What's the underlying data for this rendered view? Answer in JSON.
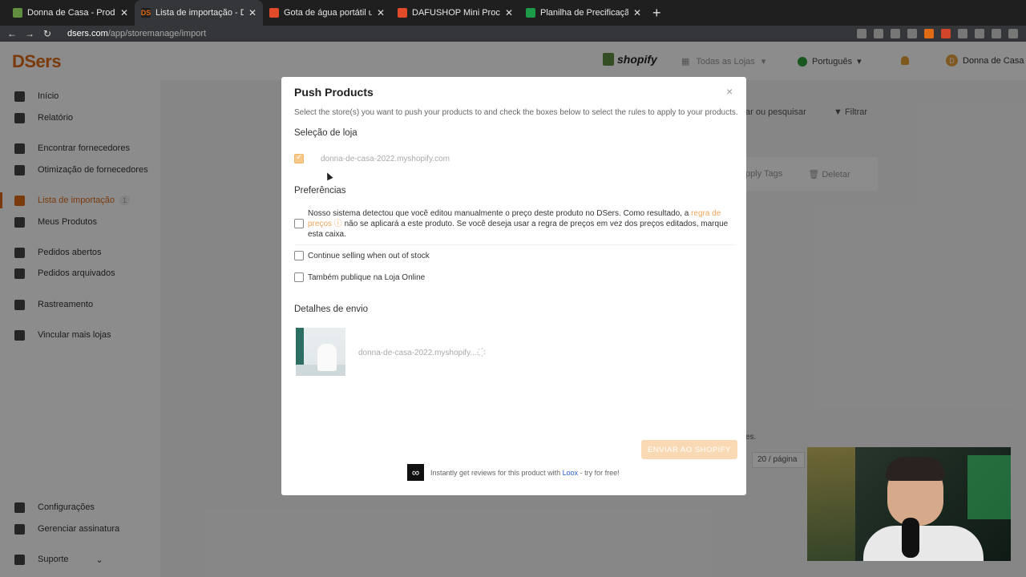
{
  "browser": {
    "tabs": [
      {
        "title": "Donna de Casa - Produtos - Sh",
        "fav_color": "#5e8e3e",
        "fav_icon": "shopify-icon",
        "active": false
      },
      {
        "title": "Lista de importação - DSers - ",
        "fav_color": "#e06b16",
        "fav_icon": "dsers-icon",
        "active": true
      },
      {
        "title": "Gota de água portátil umidifica",
        "fav_color": "#e04b2a",
        "fav_icon": "shop-icon",
        "active": false
      },
      {
        "title": "DAFUSHOP Mini Processador d",
        "fav_color": "#e04b2a",
        "fav_icon": "shop-icon",
        "active": false
      },
      {
        "title": "Planilha de Precificação.xlsx -",
        "fav_color": "#1e9a4b",
        "fav_icon": "sheets-icon",
        "active": false
      }
    ],
    "url_host": "dsers.com",
    "url_path": "/app/storemanage/import"
  },
  "app": {
    "logo": "DSers",
    "platform": "shopify",
    "store_selector": "Todas as Lojas",
    "language": "Português",
    "user": "Donna de Casa",
    "user_initial": "D",
    "sidebar": [
      {
        "label": "Início",
        "icon": "home-icon"
      },
      {
        "label": "Relatório",
        "icon": "report-icon"
      },
      {
        "label": "Encontrar fornecedores",
        "icon": "find-icon"
      },
      {
        "label": "Otimização de fornecedores",
        "icon": "search-icon"
      },
      {
        "label": "Lista de importação",
        "icon": "list-icon",
        "badge": "1",
        "active": true
      },
      {
        "label": "Meus Produtos",
        "icon": "bag-icon"
      },
      {
        "label": "Pedidos abertos",
        "icon": "clipboard-icon"
      },
      {
        "label": "Pedidos arquivados",
        "icon": "archive-icon"
      },
      {
        "label": "Rastreamento",
        "icon": "truck-icon"
      },
      {
        "label": "Vincular mais lojas",
        "icon": "link-icon"
      },
      {
        "label": "Configurações",
        "icon": "gear-icon"
      },
      {
        "label": "Gerenciar assinatura",
        "icon": "sliders-icon"
      },
      {
        "label": "Suporte",
        "icon": "help-icon"
      }
    ],
    "bg_search": "ar ou pesquisar",
    "bg_filter": "Filtrar",
    "bg_apply_tags": "pply Tags",
    "bg_delete": "Deletar",
    "bg_text": "es.",
    "bg_page_size": "20 / página"
  },
  "modal": {
    "title": "Push Products",
    "close": "×",
    "subtitle": "Select the store(s) you want to push your products to and check the boxes below to select the rules to apply to your products.",
    "store_section": "Seleção de loja",
    "store_name": "donna-de-casa-2022.myshopify.com",
    "store_checked": true,
    "pref_section": "Preferências",
    "pref_text_1": "Nosso sistema detectou que você editou manualmente o preço deste produto no DSers. Como resultado, a ",
    "pref_link": "regra de preços ⓘ",
    "pref_text_2": " não se aplicará a este produto. Se você deseja usar a regra de preços em vez dos preços editados, marque esta caixa.",
    "opt_continue": "Continue selling when out of stock",
    "opt_publish": "Também publique na Loja Online",
    "shipping_section": "Detalhes de envio",
    "ship_store": "donna-de-casa-2022.myshopify....",
    "send_button": "ENVIAR AO SHOPIFY",
    "loox_text_1": "Instantly get reviews for this product with ",
    "loox_brand": "Loox",
    "loox_text_2": " - try for free!"
  }
}
